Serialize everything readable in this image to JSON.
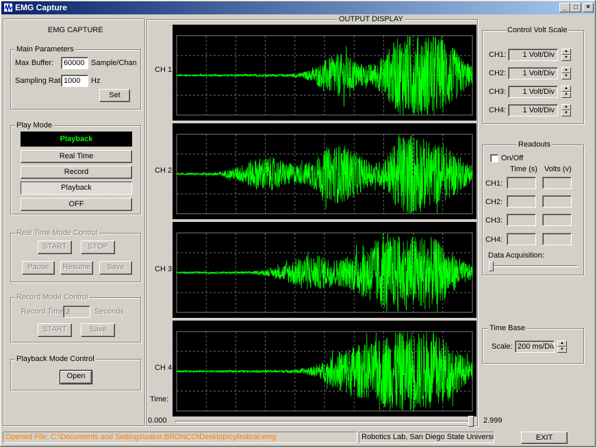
{
  "window": {
    "title": "EMG Capture",
    "minimize": "_",
    "maximize": "□",
    "close": "×"
  },
  "left": {
    "heading": "EMG CAPTURE",
    "main_params": {
      "legend": "Main Parameters",
      "max_buffer_label": "Max Buffer:",
      "max_buffer_value": "60000",
      "max_buffer_unit": "Sample/Chan",
      "sampling_rate_label": "Sampling Rate:",
      "sampling_rate_value": "1000",
      "sampling_rate_unit": "Hz",
      "set_label": "Set"
    },
    "play_mode": {
      "legend": "Play Mode",
      "indicator": "Playback",
      "indicator_color": "#00ff00",
      "real_time": "Real Time",
      "record": "Record",
      "playback": "Playback",
      "off": "OFF"
    },
    "real_time_control": {
      "legend": "Real Time Mode Control",
      "start": "START",
      "stop": "STOP",
      "pause": "Pause",
      "resume": "Resume",
      "save": "Save"
    },
    "record_control": {
      "legend": "Record Mode Control",
      "record_time_label": "Record Time:",
      "record_time_value": "2",
      "seconds": "Seconds",
      "start": "START",
      "save": "Save"
    },
    "playback_control": {
      "legend": "Playback Mode Control",
      "open": "Open"
    }
  },
  "output": {
    "title": "OUTPUT DISPLAY",
    "channels": [
      "CH 1",
      "CH 2",
      "CH 3",
      "CH 4"
    ],
    "trace_color": "#00ff00",
    "time_label": "Time:",
    "time_start": "0.000",
    "time_end": "2.999",
    "time_slider_position": 1.0
  },
  "control_volt": {
    "legend": "Control Volt Scale",
    "rows": [
      {
        "label": "CH1:",
        "value": "1 Volt/Div"
      },
      {
        "label": "CH2:",
        "value": "1 Volt/Div"
      },
      {
        "label": "CH3:",
        "value": "1 Volt/Div"
      },
      {
        "label": "CH4:",
        "value": "1 Volt/Div"
      }
    ]
  },
  "readouts": {
    "legend": "Readouts",
    "onoff": "On/Off",
    "time_header": "Time (s)",
    "volts_header": "Volts (v)",
    "rows": [
      "CH1:",
      "CH2:",
      "CH3:",
      "CH4:"
    ],
    "acq_label": "Data Acquisition:",
    "acq_slider_position": 0.0
  },
  "time_base": {
    "legend": "Time Base",
    "scale_label": "Scale:",
    "scale_value": "200 ms/Div"
  },
  "status": {
    "file": "Opened File: C:\\Documents and Settings\\saksr.BRONCO\\Desktop\\cylindical.emg",
    "file_color": "#ff8000",
    "lab": "Robotics Lab, San Diego State University",
    "exit": "EXIT"
  }
}
